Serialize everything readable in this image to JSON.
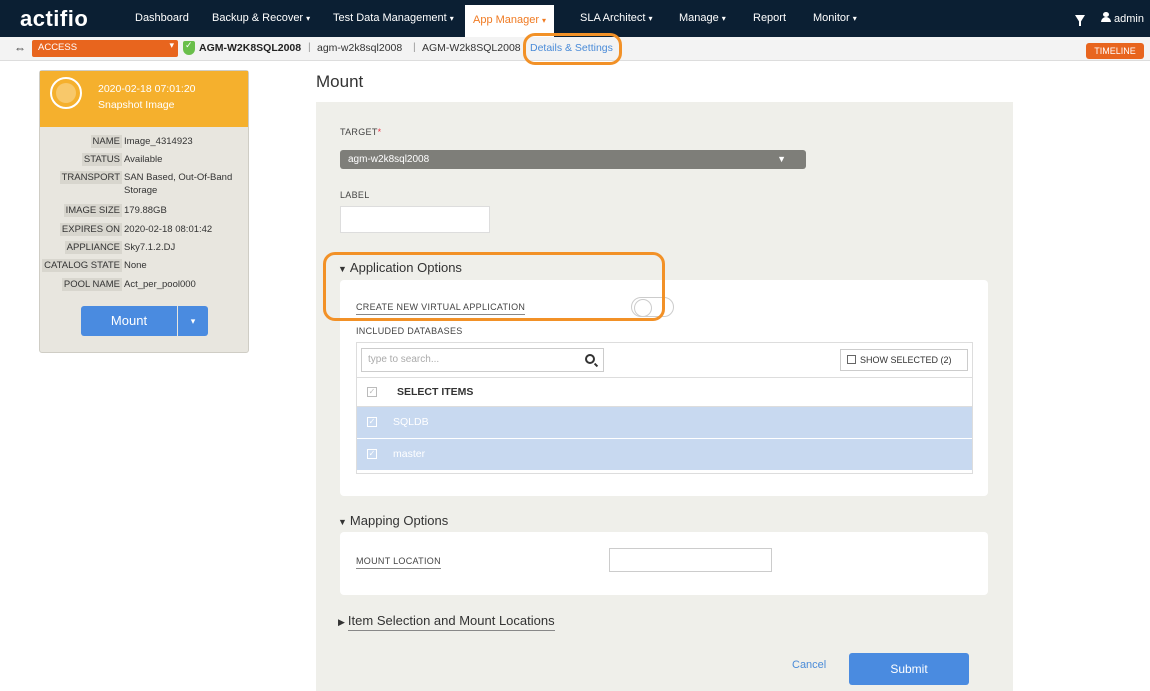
{
  "brand": {
    "logo": "actifio"
  },
  "nav": {
    "items": [
      {
        "label": "Dashboard"
      },
      {
        "label": "Backup & Recover"
      },
      {
        "label": "Test Data Management"
      },
      {
        "label": "App Manager"
      },
      {
        "label": "SLA Architect"
      },
      {
        "label": "Manage"
      },
      {
        "label": "Report"
      },
      {
        "label": "Monitor"
      }
    ],
    "user": "admin"
  },
  "crumbs": {
    "access": "ACCESS",
    "app_name": "AGM-W2K8SQL2008",
    "host": "agm-w2k8sql2008",
    "appliance": "AGM-W2k8SQL2008",
    "details": "Details & Settings",
    "timeline": "TIMELINE"
  },
  "card": {
    "date": "2020-02-18  07:01:20",
    "type": "Snapshot Image",
    "props": [
      {
        "k": "NAME",
        "v": "Image_4314923"
      },
      {
        "k": "STATUS",
        "v": "Available"
      },
      {
        "k": "TRANSPORT",
        "v": "SAN Based, Out-Of-Band Storage"
      },
      {
        "k": "IMAGE SIZE",
        "v": "179.88GB"
      },
      {
        "k": "EXPIRES ON",
        "v": "2020-02-18 08:01:42"
      },
      {
        "k": "APPLIANCE",
        "v": "Sky7.1.2.DJ"
      },
      {
        "k": "CATALOG STATE",
        "v": "None"
      },
      {
        "k": "POOL NAME",
        "v": "Act_per_pool000"
      }
    ],
    "mount_label": "Mount"
  },
  "main": {
    "title": "Mount",
    "target_label": "TARGET",
    "target_required": "*",
    "target_value": "agm-w2k8sql2008",
    "label_label": "LABEL",
    "app_options": "Application Options",
    "create_new": "CREATE NEW VIRTUAL APPLICATION",
    "included_dbs": "INCLUDED DATABASES",
    "search_placeholder": "type to search...",
    "show_selected": "SHOW SELECTED (2)",
    "select_items": "SELECT ITEMS",
    "databases": [
      "SQLDB",
      "master"
    ],
    "mapping_options": "Mapping Options",
    "mount_location": "MOUNT LOCATION",
    "item_selection": "Item Selection and Mount Locations",
    "cancel": "Cancel",
    "submit": "Submit"
  },
  "colors": {
    "nav_bg": "#0b1f33",
    "accent_orange": "#e8651e",
    "primary_blue": "#4a8be0",
    "card_head": "#f5b02d"
  }
}
